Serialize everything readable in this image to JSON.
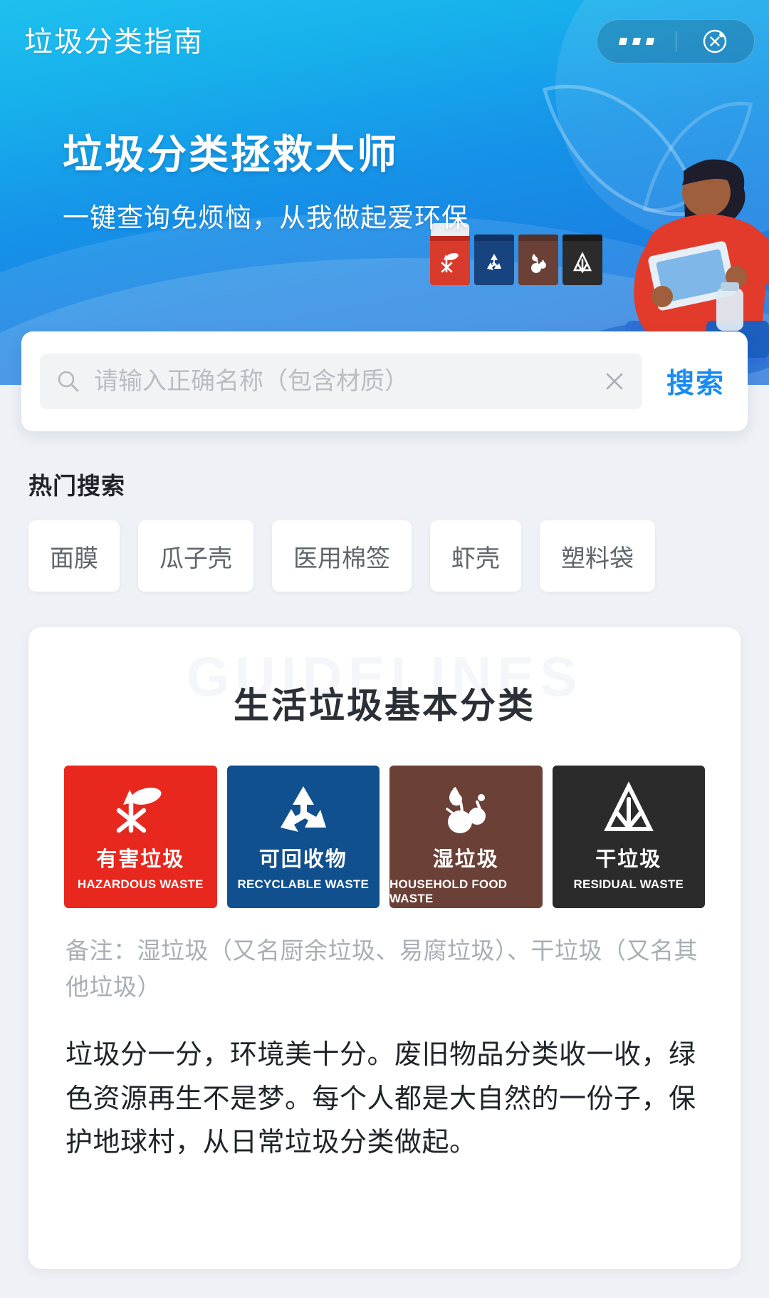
{
  "navbar": {
    "title": "垃圾分类指南",
    "more_icon": "more-dots-icon",
    "close_icon": "close-target-icon"
  },
  "hero": {
    "title": "垃圾分类拯救大师",
    "subtitle": "一键查询免烦恼，从我做起爱环保"
  },
  "search": {
    "placeholder": "请输入正确名称（包含材质）",
    "value": "",
    "search_icon": "search-icon",
    "clear_icon": "clear-x-icon",
    "button_label": "搜索",
    "button_color": "#1a8cf0"
  },
  "hot_search": {
    "heading": "热门搜索",
    "tags": [
      "面膜",
      "瓜子壳",
      "医用棉签",
      "虾壳",
      "塑料袋"
    ]
  },
  "guide": {
    "watermark": "GUIDELINES",
    "title": "生活垃圾基本分类",
    "categories": [
      {
        "cn": "有害垃圾",
        "en": "HAZARDOUS WASTE",
        "color": "#e8281e",
        "icon": "hazardous-waste-icon"
      },
      {
        "cn": "可回收物",
        "en": "RECYCLABLE WASTE",
        "color": "#11508f",
        "icon": "recycle-icon"
      },
      {
        "cn": "湿垃圾",
        "en": "HOUSEHOLD FOOD WASTE",
        "color": "#6b4036",
        "icon": "food-waste-icon"
      },
      {
        "cn": "干垃圾",
        "en": "RESIDUAL WASTE",
        "color": "#2b2b2b",
        "icon": "residual-waste-icon"
      }
    ],
    "note": "备注：湿垃圾（又名厨余垃圾、易腐垃圾）、干垃圾（又名其他垃圾）",
    "body": "垃圾分一分，环境美十分。废旧物品分类收一收，绿色资源再生不是梦。每个人都是大自然的一份子，保护地球村，从日常垃圾分类做起。"
  },
  "illustration": {
    "bins": [
      {
        "color": "#d83b2c",
        "lid": "#b8291c",
        "icon": "hazardous-waste-icon"
      },
      {
        "color": "#17437e",
        "lid": "#0f3465",
        "icon": "recycle-icon"
      },
      {
        "color": "#6b4036",
        "lid": "#54312a",
        "icon": "food-waste-icon"
      },
      {
        "color": "#2b2b2b",
        "lid": "#1a1a1a",
        "icon": "residual-waste-icon"
      }
    ],
    "person": "person-with-tablet-illustration"
  }
}
